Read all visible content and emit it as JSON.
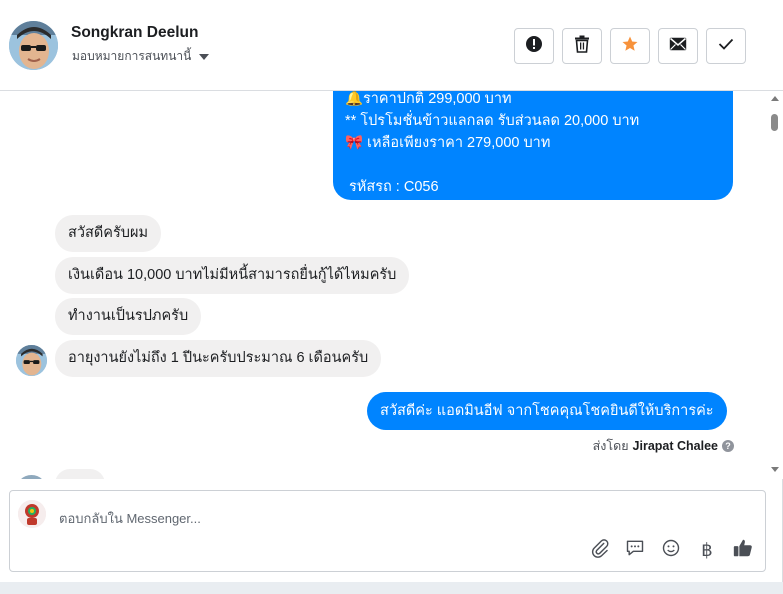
{
  "header": {
    "name": "Songkran Deelun",
    "assign_label": "มอบหมายการสนทนานี้"
  },
  "toolbar": {
    "spam_icon": "exclamation-circle-icon",
    "delete_icon": "trash-icon",
    "star_icon": "star-icon",
    "unread_icon": "envelope-icon",
    "done_icon": "checkmark-icon",
    "star_color": "#f7923b"
  },
  "messages": {
    "outgoing_card": [
      {
        "emoji": "🔔",
        "text": "ราคาปกติ 299,000 บาท"
      },
      {
        "emoji": "",
        "text": "** โปรโมชั่นข้าวแลกลด รับส่วนลด 20,000 บาท"
      },
      {
        "emoji": "🎀",
        "text": "เหลือเพียงราคา 279,000 บาท"
      },
      {
        "emoji": "",
        "text": ""
      },
      {
        "emoji": "",
        "text": "รหัสรถ : C056"
      }
    ],
    "incoming": [
      "สวัสดีครับผม",
      "เงินเดือน 10,000 บาทไม่มีหนี้สามารถยื่นกู้ได้ไหมครับ",
      "ทำงานเป็นรปภครับ",
      "อายุงานยังไม่ถึง 1 ปีนะครับประมาณ 6 เดือนครับ"
    ],
    "reply": "สวัสดีค่ะ แอดมินอีฟ จากโชคคุณโชคยินดีให้บริการค่ะ",
    "sent_by_label": "ส่งโดย",
    "sent_by_name": "Jirapat Chalee"
  },
  "composer": {
    "placeholder": "ตอบกลับใน Messenger...",
    "tools": [
      "paperclip-icon",
      "saved-reply-icon",
      "emoji-icon",
      "baht-icon",
      "thumbs-up-icon"
    ],
    "baht_symbol": "฿"
  },
  "colors": {
    "accent": "#0084ff",
    "incoming_bubble": "#f1f0f0"
  }
}
